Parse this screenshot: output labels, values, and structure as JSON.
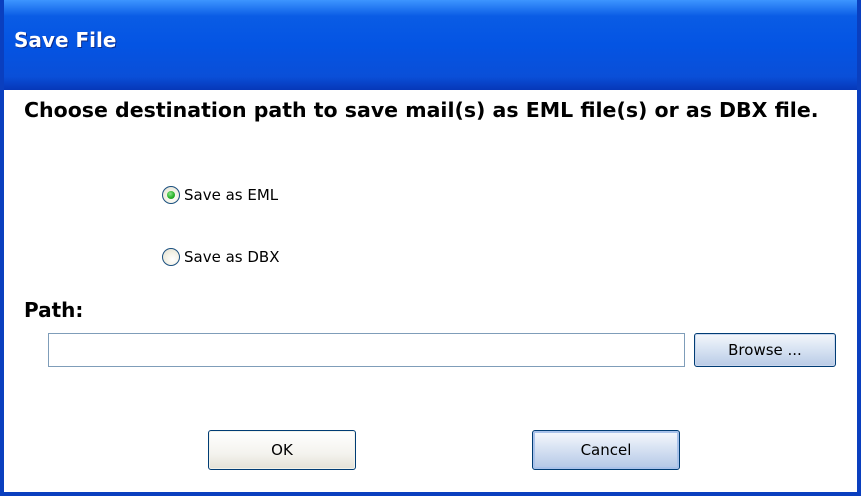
{
  "window": {
    "title": "Save File"
  },
  "dialog": {
    "instruction": "Choose destination path to save mail(s) as EML file(s) or as DBX file.",
    "options": [
      {
        "label": "Save as EML",
        "selected": true
      },
      {
        "label": "Save as DBX",
        "selected": false
      }
    ],
    "path_label": "Path:",
    "path_value": "",
    "browse_label": "Browse ...",
    "ok_label": "OK",
    "cancel_label": "Cancel"
  },
  "colors": {
    "titlebar": "#0454e3",
    "frame": "#0a3fbf",
    "radio_selected": "#2bb52b"
  }
}
